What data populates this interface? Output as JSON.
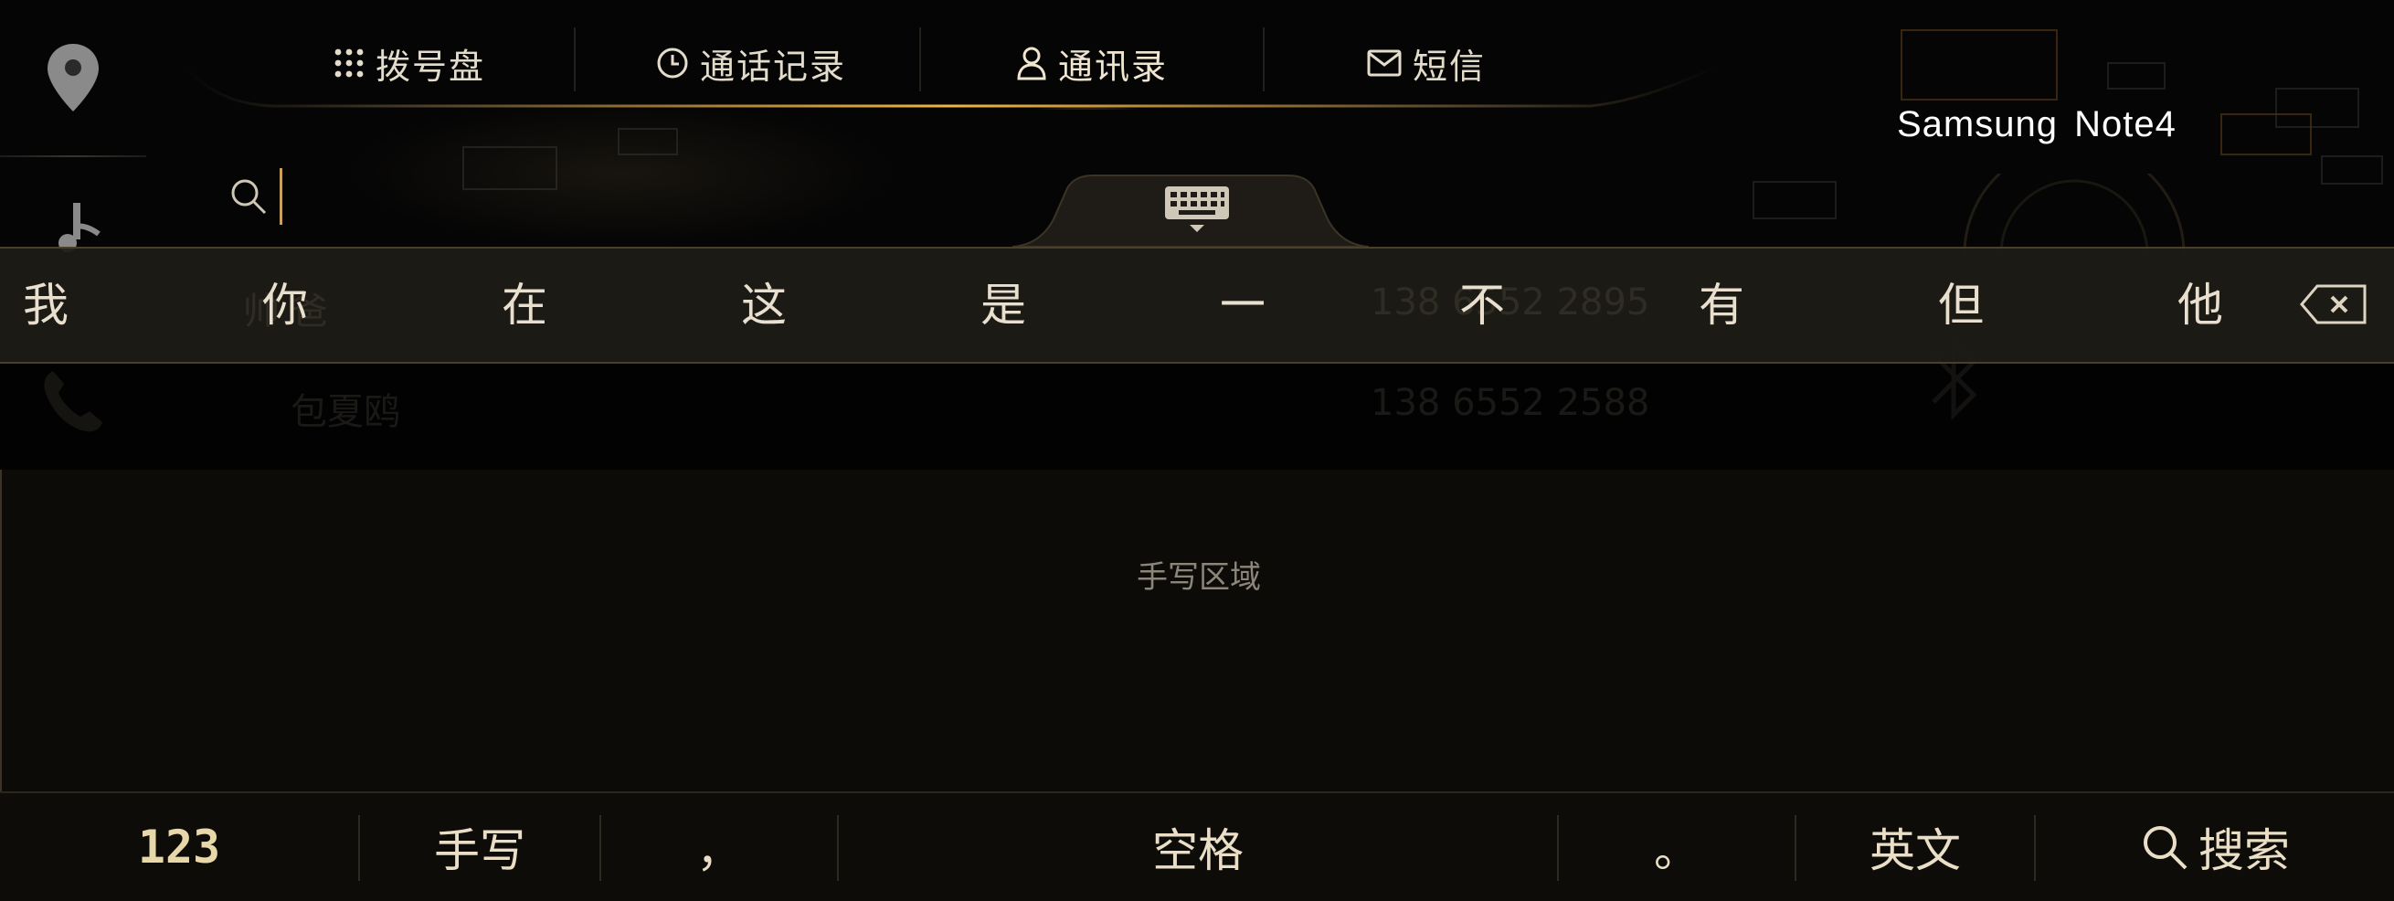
{
  "nav": {
    "tabs": [
      {
        "label": "拨号盘",
        "icon": "dialpad-icon"
      },
      {
        "label": "通话记录",
        "icon": "clock-icon"
      },
      {
        "label": "通讯录",
        "icon": "person-icon",
        "active": true
      },
      {
        "label": "短信",
        "icon": "envelope-icon"
      }
    ]
  },
  "device": {
    "name": "Samsung Note4"
  },
  "search": {
    "value": ""
  },
  "background_list": {
    "rows": [
      {
        "name": "帅 爸",
        "phone": "138 6552 2895"
      },
      {
        "name": "包夏鸥",
        "phone": "138 6552 2588"
      }
    ]
  },
  "candidates": [
    "我",
    "你",
    "在",
    "这",
    "是",
    "一",
    "不",
    "有",
    "但",
    "他"
  ],
  "handwriting": {
    "label": "手写区域"
  },
  "keys": {
    "numbers": "123",
    "handwrite": "手写",
    "comma": "，",
    "space": "空格",
    "period": "。",
    "english": "英文",
    "search": "搜索"
  },
  "colors": {
    "accent_gold": "#d8a94a",
    "text": "#e8dfcf",
    "background": "#050505"
  }
}
